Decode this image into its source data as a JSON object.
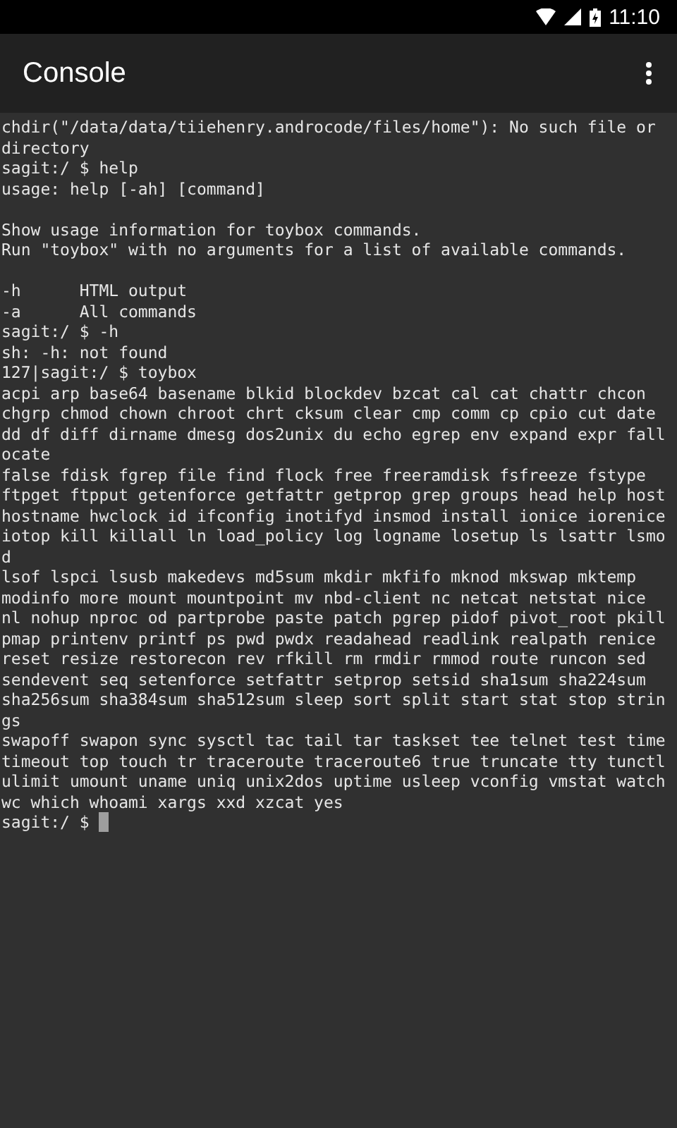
{
  "status_bar": {
    "time": "11:10"
  },
  "app_bar": {
    "title": "Console"
  },
  "console": {
    "blocks": [
      {
        "lines": [
          "chdir(\"/data/data/tiiehenry.androcode/files/home\"): No such file or",
          "directory",
          "sagit:/ $ help",
          "usage: help [-ah] [command]"
        ]
      },
      {
        "lines": [
          "Show usage information for toybox commands.",
          "Run \"toybox\" with no arguments for a list of available commands."
        ]
      },
      {
        "lines": [
          "-h      HTML output",
          "-a      All commands",
          "sagit:/ $ -h",
          "sh: -h: not found",
          "127|sagit:/ $ toybox",
          "acpi arp base64 basename blkid blockdev bzcat cal cat chattr chcon",
          "chgrp chmod chown chroot chrt cksum clear cmp comm cp cpio cut date",
          "dd df diff dirname dmesg dos2unix du echo egrep env expand expr fall",
          "ocate",
          "false fdisk fgrep file find flock free freeramdisk fsfreeze fstype",
          "ftpget ftpput getenforce getfattr getprop grep groups head help host",
          "hostname hwclock id ifconfig inotifyd insmod install ionice iorenice",
          "iotop kill killall ln load_policy log logname losetup ls lsattr lsmo",
          "d",
          "lsof lspci lsusb makedevs md5sum mkdir mkfifo mknod mkswap mktemp",
          "modinfo more mount mountpoint mv nbd-client nc netcat netstat nice",
          "nl nohup nproc od partprobe paste patch pgrep pidof pivot_root pkill",
          "pmap printenv printf ps pwd pwdx readahead readlink realpath renice",
          "reset resize restorecon rev rfkill rm rmdir rmmod route runcon sed",
          "sendevent seq setenforce setfattr setprop setsid sha1sum sha224sum",
          "sha256sum sha384sum sha512sum sleep sort split start stat stop strin",
          "gs",
          "swapoff swapon sync sysctl tac tail tar taskset tee telnet test time",
          "timeout top touch tr traceroute traceroute6 true truncate tty tunctl",
          "ulimit umount uname uniq unix2dos uptime usleep vconfig vmstat watch",
          "wc which whoami xargs xxd xzcat yes"
        ]
      }
    ],
    "prompt": "sagit:/ $",
    "cursor": true
  }
}
